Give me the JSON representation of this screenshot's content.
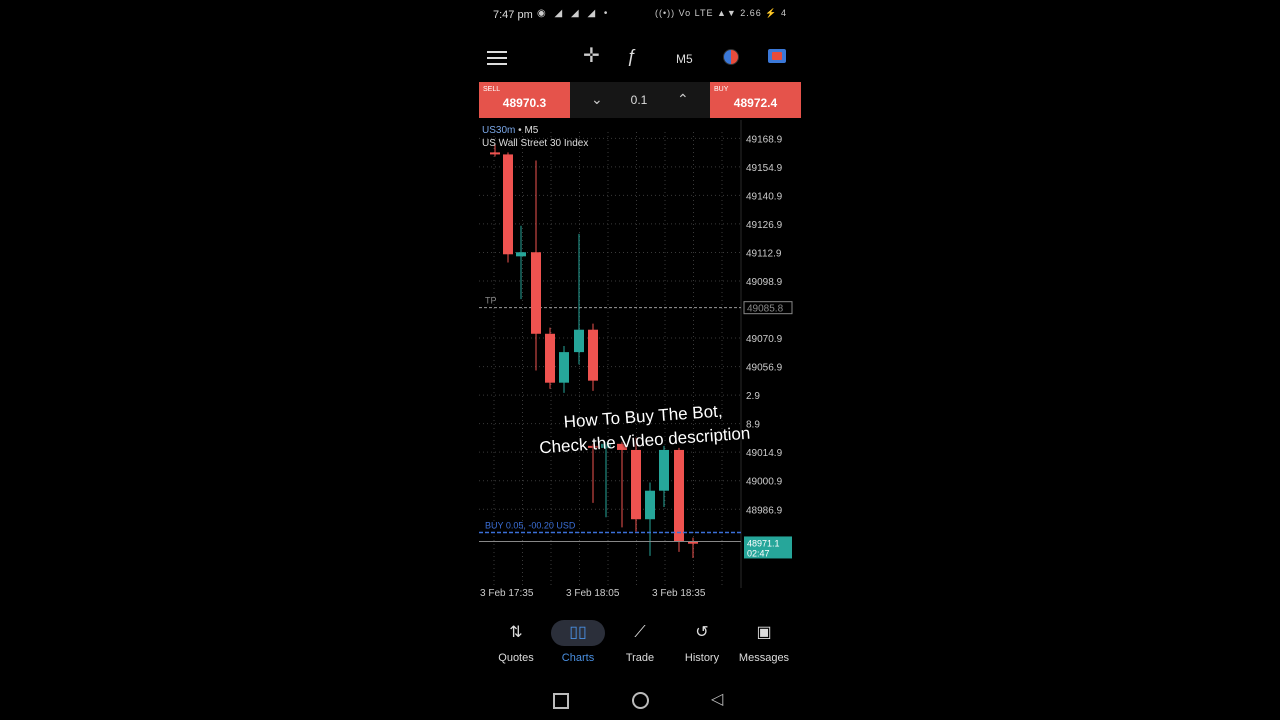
{
  "status_bar": {
    "time": "7:47 pm",
    "notifications": "◉ ◢ ◢ ◢ •",
    "system_icons": "((•)) Vo LTE ▲▼ 2.66 ⚡ 4"
  },
  "toolbar": {
    "timeframe": "M5"
  },
  "trade_panel": {
    "sell_label": "SELL",
    "sell_price": "48970.3",
    "volume": "0.1",
    "buy_label": "BUY",
    "buy_price": "48972.4"
  },
  "chart": {
    "symbol": "US30m",
    "symbol_timeframe": "M5",
    "description": "US Wall Street 30 Index",
    "tp_label": "TP",
    "tp_price": "49085.8",
    "position_label": "BUY 0.05, -00.20 USD",
    "current_price": "48971.1",
    "countdown": "02:47",
    "overlay_line1": "How To Buy The Bot,",
    "overlay_line2": "Check the Video description",
    "colors": {
      "bull": "#26a69a",
      "bear": "#ef5350",
      "position_line": "#3b6fd8",
      "price_tag": "#26a69a"
    }
  },
  "chart_data": {
    "type": "candlestick",
    "x_labels": [
      "3 Feb 17:35",
      "3 Feb 18:05",
      "3 Feb 18:35"
    ],
    "y_ticks": [
      "49168.9",
      "49154.9",
      "49140.9",
      "49126.9",
      "49112.9",
      "49098.9",
      "49070.9",
      "49056.9",
      "49042.9",
      "49028.9",
      "49014.9",
      "49000.9",
      "48986.9"
    ],
    "y_ticks_visible": [
      "49168.9",
      "49154.9",
      "49140.9",
      "49126.9",
      "49112.9",
      "49098.9",
      "49070.9",
      "49056.9",
      "2.9",
      "8.9",
      "49014.9",
      "49000.9",
      "48986.9"
    ],
    "ylim": [
      48962,
      49172
    ],
    "candles": [
      {
        "o": 49162,
        "h": 49166,
        "l": 49160,
        "c": 49161
      },
      {
        "o": 49161,
        "h": 49162,
        "l": 49108,
        "c": 49112
      },
      {
        "o": 49111,
        "h": 49126,
        "l": 49090,
        "c": 49113
      },
      {
        "o": 49113,
        "h": 49158,
        "l": 49055,
        "c": 49073
      },
      {
        "o": 49073,
        "h": 49076,
        "l": 49046,
        "c": 49049
      },
      {
        "o": 49049,
        "h": 49067,
        "l": 49044,
        "c": 49064
      },
      {
        "o": 49064,
        "h": 49122,
        "l": 49058,
        "c": 49075
      },
      {
        "o": 49075,
        "h": 49078,
        "l": 49045,
        "c": 49050
      },
      {
        "o": 49018,
        "h": 49019,
        "l": 48990,
        "c": 49017
      },
      {
        "o": 49017,
        "h": 49020,
        "l": 48983,
        "c": 49019
      },
      {
        "o": 49019,
        "h": 49020,
        "l": 48978,
        "c": 49016
      },
      {
        "o": 49016,
        "h": 49022,
        "l": 48976,
        "c": 48982
      },
      {
        "o": 48982,
        "h": 49000,
        "l": 48964,
        "c": 48996
      },
      {
        "o": 48996,
        "h": 49018,
        "l": 48988,
        "c": 49016
      },
      {
        "o": 49016,
        "h": 49017,
        "l": 48966,
        "c": 48971
      },
      {
        "o": 48971,
        "h": 48973,
        "l": 48963,
        "c": 48970
      }
    ],
    "candle_x": [
      2,
      15,
      28,
      43,
      57,
      71,
      86,
      100,
      100,
      113,
      129,
      143,
      157,
      171,
      186,
      200
    ],
    "tp_level": 49085.8,
    "position_level": 48975.5,
    "current_level": 48971.1
  }
}
